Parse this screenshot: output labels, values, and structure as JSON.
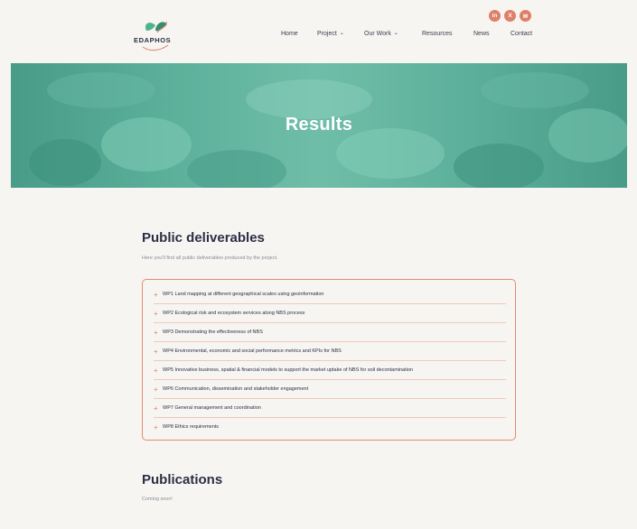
{
  "brand": {
    "name": "EDAPHOS"
  },
  "colors": {
    "accent": "#e07f67",
    "hero": "#5fb8a3",
    "background": "#f7f5f1",
    "text": "#2a2f45"
  },
  "social": [
    {
      "icon": "linkedin-icon",
      "glyph": "in"
    },
    {
      "icon": "x-icon",
      "glyph": "X"
    },
    {
      "icon": "email-icon",
      "glyph": "✉"
    }
  ],
  "nav": {
    "items": [
      {
        "label": "Home",
        "dropdown": false
      },
      {
        "label": "Project",
        "dropdown": true
      },
      {
        "label": "Our Work",
        "dropdown": true
      },
      {
        "label": "Resources",
        "dropdown": false
      },
      {
        "label": "News",
        "dropdown": false
      },
      {
        "label": "Contact",
        "dropdown": false
      }
    ],
    "chevron": "⌄"
  },
  "hero": {
    "title": "Results"
  },
  "deliverables": {
    "heading": "Public deliverables",
    "intro": "Here you'll find all public deliverables produced by the project.",
    "items": [
      "WP1 Land mapping at different geographical scales using geoinformation",
      "WP2 Ecological risk and ecosystem services along NBS process",
      "WP3 Demonstrating the effectiveness of NBS",
      "WP4 Environmental, economic and social performance metrics and KPIs for NBS",
      "WP5 Innovative business, spatial & financial models to support the market uptake of NBS for soil decontamination",
      "WP6 Communication, dissemination and stakeholder engagement",
      "WP7 General management and coordination",
      "WP8 Ethics requirements"
    ]
  },
  "publications": {
    "heading": "Publications",
    "text": "Coming soon!"
  }
}
